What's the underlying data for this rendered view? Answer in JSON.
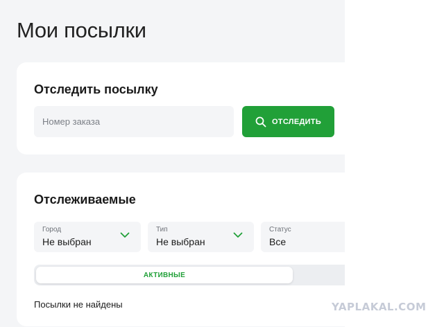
{
  "page": {
    "title": "Мои посылки"
  },
  "track_card": {
    "title": "Отследить посылку",
    "input_placeholder": "Номер заказа",
    "input_value": "",
    "button_label": "ОТСЛЕДИТЬ",
    "button_icon": "search-icon"
  },
  "tracked_card": {
    "title": "Отслеживаемые",
    "filters": [
      {
        "label": "Город",
        "value": "Не выбран",
        "icon": "chevron-down-icon"
      },
      {
        "label": "Тип",
        "value": "Не выбран",
        "icon": "chevron-down-icon"
      },
      {
        "label": "Статус",
        "value": "Все"
      }
    ],
    "tabs": [
      {
        "label": "АКТИВНЫЕ",
        "active": true
      }
    ],
    "empty_message": "Посылки не найдены"
  },
  "watermark": "YAPLAKAL.COM",
  "colors": {
    "accent": "#21a038",
    "page_background": "#f4f5f7",
    "card_background": "#ffffff",
    "input_background": "#f4f5f7",
    "watermark": "#c6cbd7"
  }
}
